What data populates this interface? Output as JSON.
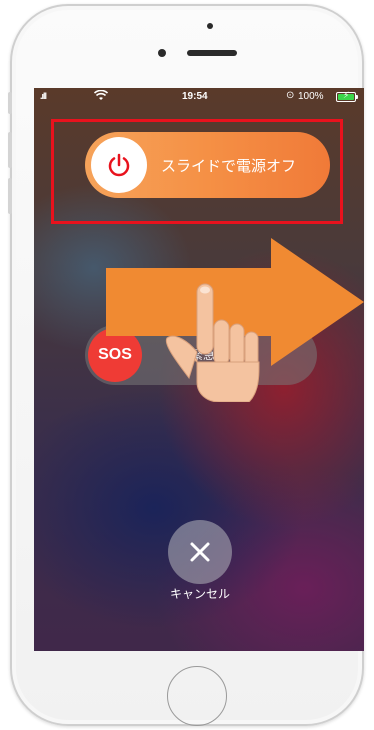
{
  "status_bar": {
    "signal": "▐▐▐",
    "time": "19:54",
    "battery_text": "100%",
    "battery_color": "#3cd64a"
  },
  "power_slider": {
    "label": "スライドで電源オフ",
    "icon": "power-icon",
    "color": "#f59045"
  },
  "sos_slider": {
    "knob_label": "SOS",
    "label": "緊急SOS",
    "color": "#ef3b35"
  },
  "cancel": {
    "label": "キャンセル",
    "icon": "close-icon"
  },
  "annotation": {
    "highlight_color": "#e8121d",
    "arrow_color": "#f08a32",
    "hand_icon": "pointing-hand-icon"
  }
}
